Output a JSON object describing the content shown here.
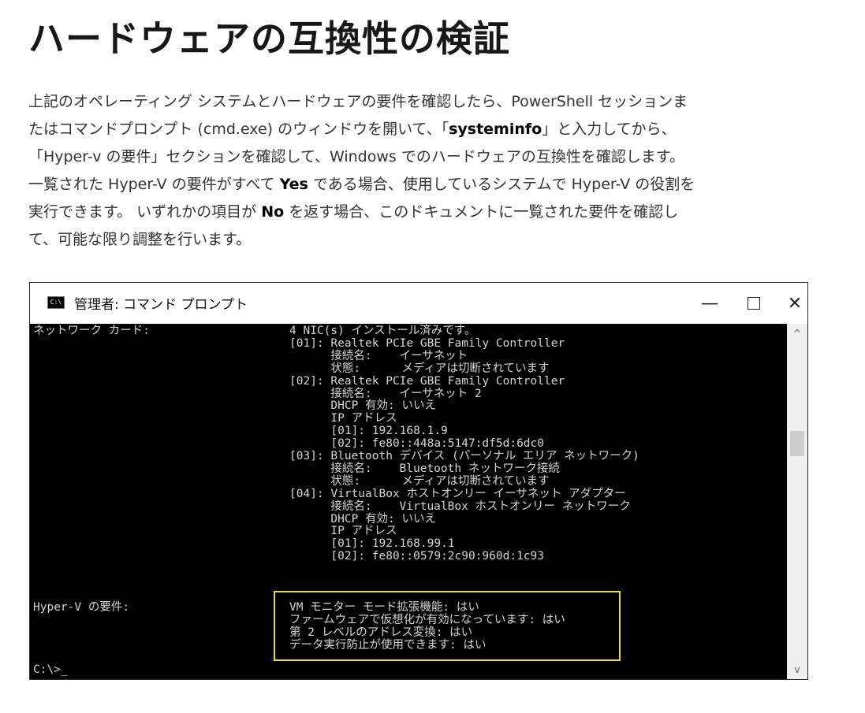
{
  "heading": "ハードウェアの互換性の検証",
  "paragraph": {
    "l1": "上記のオペレーティング システムとハードウェアの要件を確認したら、PowerShell セッションま",
    "l2a": "たはコマンドプロンプト (cmd.exe) のウィンドウを開いて、「",
    "l2b": "systeminfo",
    "l2c": "」と入力してから、",
    "l3": "「Hyper-v の要件」セクションを確認して、Windows でのハードウェアの互換性を確認します。",
    "l4a": "一覧された Hyper-V の要件がすべて ",
    "l4b": "Yes",
    "l4c": " である場合、使用しているシステムで Hyper-V の役割を",
    "l5a": "実行できます。 いずれかの項目が ",
    "l5b": "No",
    "l5c": " を返す場合、このドキュメントに一覧された要件を確認し",
    "l6": "て、可能な限り調整を行います。"
  },
  "window": {
    "icon_label": "C:\\",
    "title": "管理者: コマンド プロンプト",
    "minimize": "—",
    "close": "✕",
    "scroll_up": "^",
    "scroll_down": "v"
  },
  "console": {
    "net_label": "ネットワーク カード:",
    "lines": [
      "4 NIC(s) インストール済みです。",
      "[01]: Realtek PCIe GBE Family Controller",
      "      接続名:    イーサネット",
      "      状態:      メディアは切断されています",
      "[02]: Realtek PCIe GBE Family Controller",
      "      接続名:    イーサネット 2",
      "      DHCP 有効: いいえ",
      "      IP アドレス",
      "      [01]: 192.168.1.9",
      "      [02]: fe80::448a:5147:df5d:6dc0",
      "[03]: Bluetooth デバイス (パーソナル エリア ネットワーク)",
      "      接続名:    Bluetooth ネットワーク接続",
      "      状態:      メディアは切断されています",
      "[04]: VirtualBox ホストオンリー イーサネット アダプター",
      "      接続名:    VirtualBox ホストオンリー ネットワーク",
      "      DHCP 有効: いいえ",
      "      IP アドレス",
      "      [01]: 192.168.99.1",
      "      [02]: fe80::0579:2c90:960d:1c93"
    ],
    "hyperv_label": "Hyper-V の要件:",
    "hyperv_lines": [
      "VM モニター モード拡張機能: はい",
      "ファームウェアで仮想化が有効になっています: はい",
      "第 2 レベルのアドレス変換: はい",
      "データ実行防止が使用できます: はい"
    ],
    "prompt": "C:\\>_"
  },
  "colors": {
    "highlight_border": "#e6e02a",
    "console_bg": "#000000",
    "console_text": "#d4d4d4"
  }
}
